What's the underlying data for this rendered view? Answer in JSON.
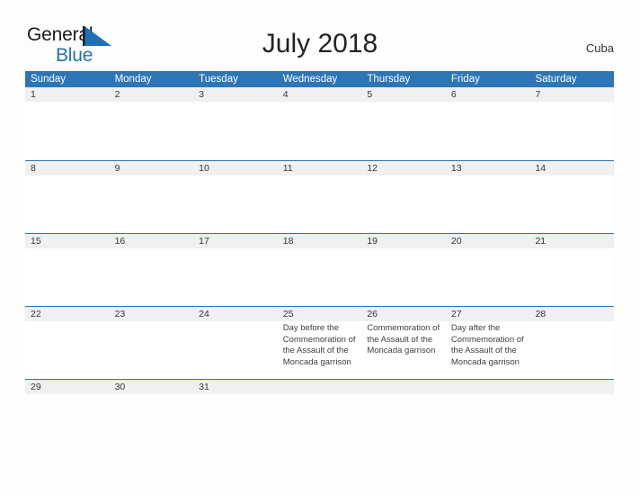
{
  "brand": {
    "line1": "General",
    "line2": "Blue",
    "flag_icon": "blue-flag-triangle",
    "accent_color": "#2272b8"
  },
  "header": {
    "title": "July 2018",
    "region": "Cuba"
  },
  "colors": {
    "header_blue": "#2e75b6",
    "row_band_gray": "#f0f0f0",
    "page_background": "#fdfdfd",
    "text_dark": "#333333"
  },
  "calendar": {
    "month": "July",
    "year": "2018",
    "weekday_headers": [
      "Sunday",
      "Monday",
      "Tuesday",
      "Wednesday",
      "Thursday",
      "Friday",
      "Saturday"
    ],
    "weeks": [
      {
        "days": [
          {
            "num": "1",
            "events": []
          },
          {
            "num": "2",
            "events": []
          },
          {
            "num": "3",
            "events": []
          },
          {
            "num": "4",
            "events": []
          },
          {
            "num": "5",
            "events": []
          },
          {
            "num": "6",
            "events": []
          },
          {
            "num": "7",
            "events": []
          }
        ]
      },
      {
        "days": [
          {
            "num": "8",
            "events": []
          },
          {
            "num": "9",
            "events": []
          },
          {
            "num": "10",
            "events": []
          },
          {
            "num": "11",
            "events": []
          },
          {
            "num": "12",
            "events": []
          },
          {
            "num": "13",
            "events": []
          },
          {
            "num": "14",
            "events": []
          }
        ]
      },
      {
        "days": [
          {
            "num": "15",
            "events": []
          },
          {
            "num": "16",
            "events": []
          },
          {
            "num": "17",
            "events": []
          },
          {
            "num": "18",
            "events": []
          },
          {
            "num": "19",
            "events": []
          },
          {
            "num": "20",
            "events": []
          },
          {
            "num": "21",
            "events": []
          }
        ]
      },
      {
        "days": [
          {
            "num": "22",
            "events": []
          },
          {
            "num": "23",
            "events": []
          },
          {
            "num": "24",
            "events": []
          },
          {
            "num": "25",
            "events": [
              "Day before the Commemoration of the Assault of the Moncada garrison"
            ]
          },
          {
            "num": "26",
            "events": [
              "Commemoration of the Assault of the Moncada garrison"
            ]
          },
          {
            "num": "27",
            "events": [
              "Day after the Commemoration of the Assault of the Moncada garrison"
            ]
          },
          {
            "num": "28",
            "events": []
          }
        ]
      },
      {
        "days": [
          {
            "num": "29",
            "events": []
          },
          {
            "num": "30",
            "events": []
          },
          {
            "num": "31",
            "events": []
          },
          {
            "num": "",
            "events": []
          },
          {
            "num": "",
            "events": []
          },
          {
            "num": "",
            "events": []
          },
          {
            "num": "",
            "events": []
          }
        ]
      }
    ]
  }
}
